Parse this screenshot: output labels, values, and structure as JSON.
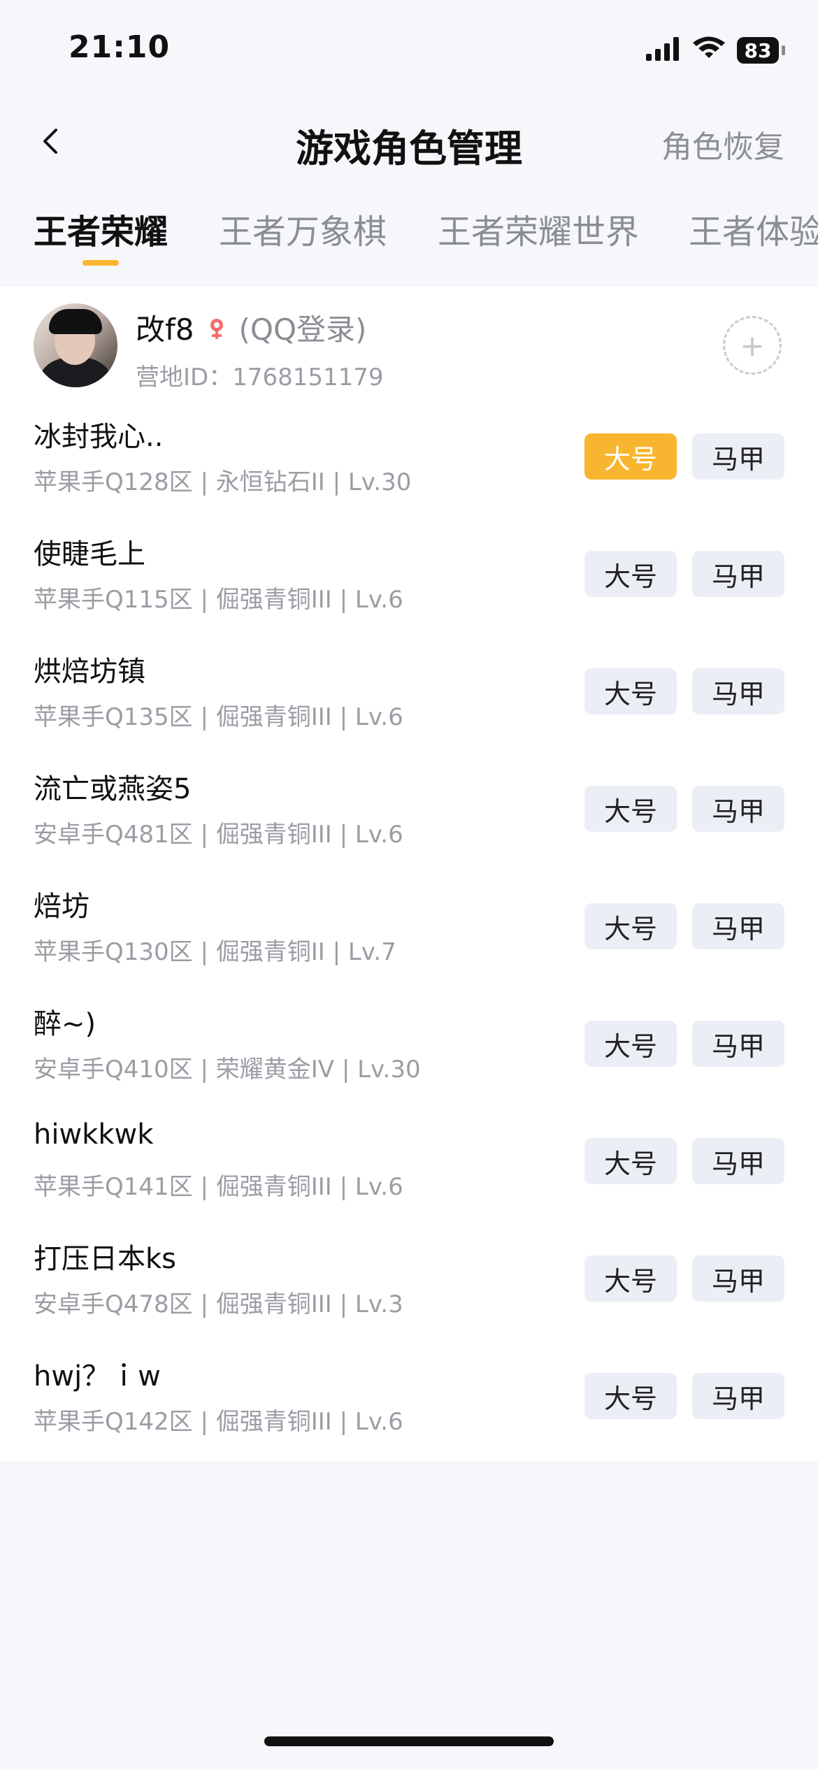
{
  "status_bar": {
    "time": "21:10",
    "battery": "83",
    "icons": [
      "cellular-signal-icon",
      "wifi-icon",
      "battery-icon"
    ]
  },
  "navigation": {
    "back_icon": "chevron-left-icon",
    "title": "游戏角色管理",
    "right_action": "角色恢复"
  },
  "tabs": [
    {
      "label": "王者荣耀",
      "active": true
    },
    {
      "label": "王者万象棋",
      "active": false
    },
    {
      "label": "王者荣耀世界",
      "active": false
    },
    {
      "label": "王者体验",
      "active": false
    }
  ],
  "profile": {
    "name": "改f8",
    "login_tag": "(QQ登录)",
    "camp_id": "营地ID：1768151179",
    "avatar_icon": "user-avatar",
    "gender_icon": "female-icon",
    "add_icon": "plus-icon"
  },
  "roles": [
    {
      "name": "冰封我心..",
      "meta": "苹果手Q128区 | 永恒钻石II | Lv.30",
      "main_label": "大号",
      "alt_label": "马甲",
      "main_selected": true
    },
    {
      "name": "使睫毛上",
      "meta": "苹果手Q115区 | 倔强青铜III | Lv.6",
      "main_label": "大号",
      "alt_label": "马甲",
      "main_selected": false
    },
    {
      "name": "烘焙坊镇",
      "meta": "苹果手Q135区 | 倔强青铜III | Lv.6",
      "main_label": "大号",
      "alt_label": "马甲",
      "main_selected": false
    },
    {
      "name": "流亡或燕姿5",
      "meta": "安卓手Q481区 | 倔强青铜III | Lv.6",
      "main_label": "大号",
      "alt_label": "马甲",
      "main_selected": false
    },
    {
      "name": "焙坊",
      "meta": "苹果手Q130区 | 倔强青铜II | Lv.7",
      "main_label": "大号",
      "alt_label": "马甲",
      "main_selected": false
    },
    {
      "name": "醉~)",
      "meta": "安卓手Q410区 | 荣耀黄金IV | Lv.30",
      "main_label": "大号",
      "alt_label": "马甲",
      "main_selected": false
    },
    {
      "name": "hiwkkwk",
      "meta": "苹果手Q141区 | 倔强青铜III | Lv.6",
      "main_label": "大号",
      "alt_label": "马甲",
      "main_selected": false
    },
    {
      "name": "打压日本ks",
      "meta": "安卓手Q478区 | 倔强青铜III | Lv.3",
      "main_label": "大号",
      "alt_label": "马甲",
      "main_selected": false
    },
    {
      "name": "hwj？ｉw",
      "meta": "苹果手Q142区 | 倔强青铜III | Lv.6",
      "main_label": "大号",
      "alt_label": "马甲",
      "main_selected": false
    }
  ],
  "colors": {
    "accent": "#f8b630",
    "background": "#f6f7fb",
    "chip": "#eceef5",
    "muted_text": "#9a9da4"
  }
}
